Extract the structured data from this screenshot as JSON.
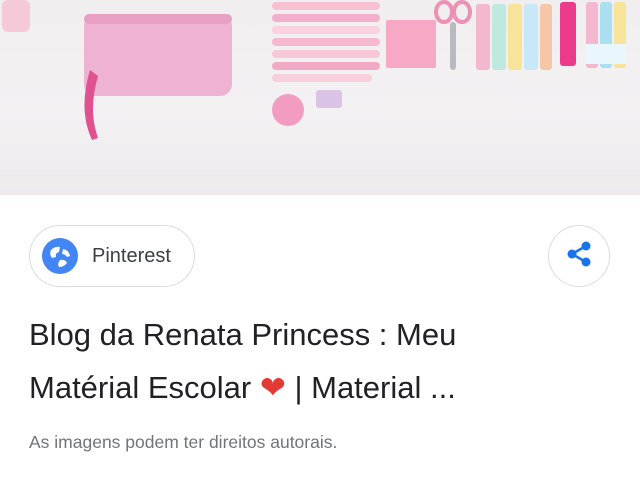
{
  "source": {
    "label": "Pinterest",
    "icon": "globe-icon"
  },
  "share": {
    "icon": "share-icon"
  },
  "result": {
    "title_line1": "Blog da Renata Princess : Meu",
    "title_line2_prefix": "Matérial Escolar ",
    "title_heart": "❤",
    "title_line2_suffix": " | Material ..."
  },
  "copyright_notice": "As imagens podem ter direitos autorais.",
  "colors": {
    "accent": "#4285f4",
    "heart": "#e53935",
    "title_text": "#202124",
    "muted_text": "#70757a",
    "border": "#dadce0"
  }
}
